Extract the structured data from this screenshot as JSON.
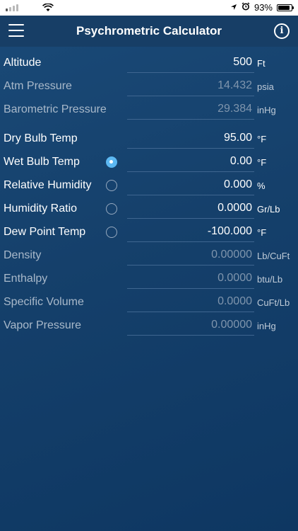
{
  "status_bar": {
    "battery": "93%",
    "wifi_icon": "wifi-icon",
    "location_icon": "location-arrow-icon",
    "alarm_icon": "alarm-clock-icon"
  },
  "nav": {
    "title": "Psychrometric Calculator",
    "menu_icon": "hamburger-menu-icon",
    "info_icon": "info-icon",
    "info_glyph": "i"
  },
  "rows": {
    "altitude": {
      "label": "Altitude",
      "value": "500",
      "unit": "Ft"
    },
    "atm_pressure": {
      "label": "Atm Pressure",
      "value": "14.432",
      "unit": "psia"
    },
    "barometric_pressure": {
      "label": "Barometric Pressure",
      "value": "29.384",
      "unit": "inHg"
    },
    "dry_bulb": {
      "label": "Dry Bulb Temp",
      "value": "95.00",
      "unit": "°F"
    },
    "wet_bulb": {
      "label": "Wet Bulb Temp",
      "value": "0.00",
      "unit": "°F",
      "selected": true
    },
    "relative_humidity": {
      "label": "Relative Humidity",
      "value": "0.000",
      "unit": "%",
      "selected": false
    },
    "humidity_ratio": {
      "label": "Humidity Ratio",
      "value": "0.0000",
      "unit": "Gr/Lb",
      "selected": false
    },
    "dew_point": {
      "label": "Dew Point Temp",
      "value": "-100.000",
      "unit": "°F",
      "selected": false
    },
    "density": {
      "label": "Density",
      "value": "0.00000",
      "unit": "Lb/CuFt"
    },
    "enthalpy": {
      "label": "Enthalpy",
      "value": "0.0000",
      "unit": "btu/Lb"
    },
    "specific_volume": {
      "label": "Specific Volume",
      "value": "0.0000",
      "unit": "CuFt/Lb"
    },
    "vapor_pressure": {
      "label": "Vapor Pressure",
      "value": "0.00000",
      "unit": "inHg"
    }
  },
  "colors": {
    "selected_radio": "#5cb8f2",
    "background": "#15406b"
  }
}
